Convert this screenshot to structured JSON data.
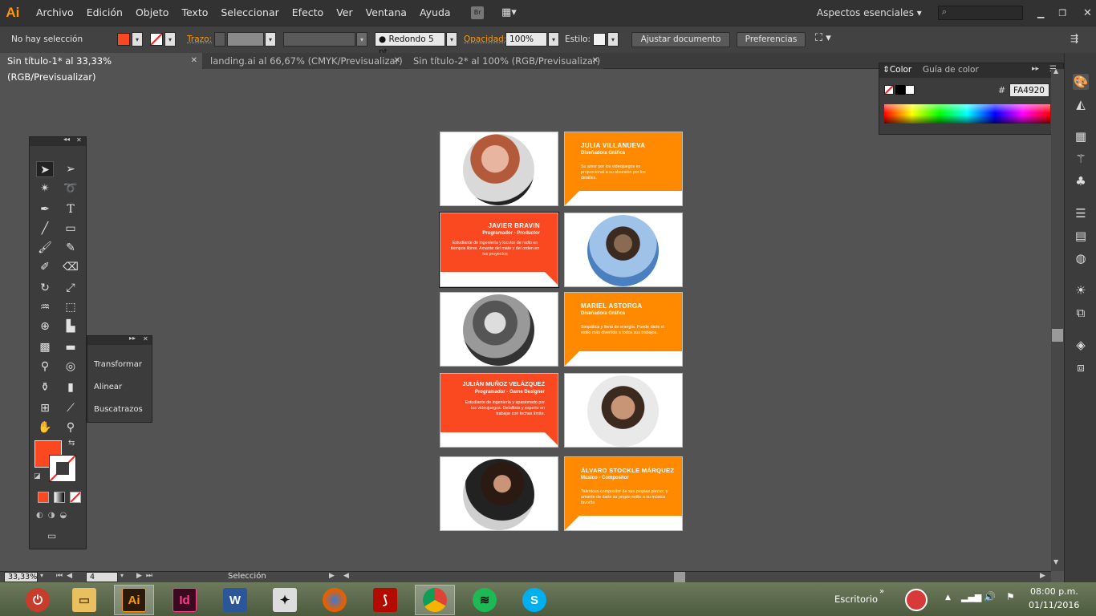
{
  "app": {
    "logo": "Ai",
    "accent": "#ff9a00"
  },
  "menu": [
    "Archivo",
    "Edición",
    "Objeto",
    "Texto",
    "Seleccionar",
    "Efecto",
    "Ver",
    "Ventana",
    "Ayuda"
  ],
  "menubar_right": {
    "bridge": "Br",
    "workspace": "Aspectos esenciales",
    "search_placeholder": ""
  },
  "control": {
    "selection": "No hay selección",
    "fill_color": "#fa4920",
    "stroke_label": "Trazo:",
    "brush": "Redondo 5 pt.",
    "opacity_label": "Opacidad:",
    "opacity": "100%",
    "style_label": "Estilo:",
    "adjust_doc": "Ajustar documento",
    "preferences": "Preferencias"
  },
  "tabs": [
    {
      "label": "Sin título-1* al 33,33% (RGB/Previsualizar)",
      "active": true
    },
    {
      "label": "landing.ai al 66,67% (CMYK/Previsualizar)",
      "active": false
    },
    {
      "label": "Sin título-2* al 100% (RGB/Previsualizar)",
      "active": false
    }
  ],
  "flyout": {
    "items": [
      "Transformar",
      "Alinear",
      "Buscatrazos"
    ]
  },
  "color_panel": {
    "tabs": [
      "Color",
      "Guía de color"
    ],
    "hex_label": "#",
    "hex": "FA4920"
  },
  "status": {
    "zoom": "33,33%",
    "artboard": "4",
    "tool": "Selección"
  },
  "taskbar": {
    "apps": [
      "power",
      "explorer",
      "Ai",
      "Id",
      "Word",
      "ZBrush",
      "Firefox",
      "Acrobat",
      "Chrome",
      "Spotify",
      "Skype"
    ],
    "desktop_label": "Escritorio",
    "time": "08:00 p.m.",
    "date": "01/11/2016"
  },
  "cards": [
    {
      "type": "text",
      "color": "#ff8a00",
      "name": "JULIA VILLANUEVA",
      "role": "Diseñadora Gráfica",
      "desc": "Su amor por los videojuegos es proporcional a su obsesión por los detalles.",
      "align": "left"
    },
    {
      "type": "text",
      "color": "#fa4920",
      "name": "JAVIER BRAVIN",
      "role": "Programador - Productor",
      "desc": "Estudiante de ingeniería y locutor de radio en tiempos libres. Amante del mate y del orden en los proyectos",
      "align": "right"
    },
    {
      "type": "text",
      "color": "#ff8a00",
      "name": "MARIEL ASTORGA",
      "role": "Diseñadora Gráfica",
      "desc": "Simpática y llena de energía. Puede darle el estilo más divertido a todos sus trabajos.",
      "align": "left"
    },
    {
      "type": "text",
      "color": "#fa4920",
      "name": "JULIÁN MUÑOZ VELÁZQUEZ",
      "role": "Programador - Game Designer",
      "desc": "Estudiante de ingeniería y apasionado por los videojuegos. Detallista y experto en trabajar con fechas límite.",
      "align": "right"
    },
    {
      "type": "text",
      "color": "#ff8a00",
      "name": "ÁLVARO STOCKLE MÁRQUEZ",
      "role": "Músico - Compositor",
      "desc": "Talentoso compositor de sus propias piezas, y amante de darle su propio estilo a su música favorita",
      "align": "left"
    }
  ]
}
